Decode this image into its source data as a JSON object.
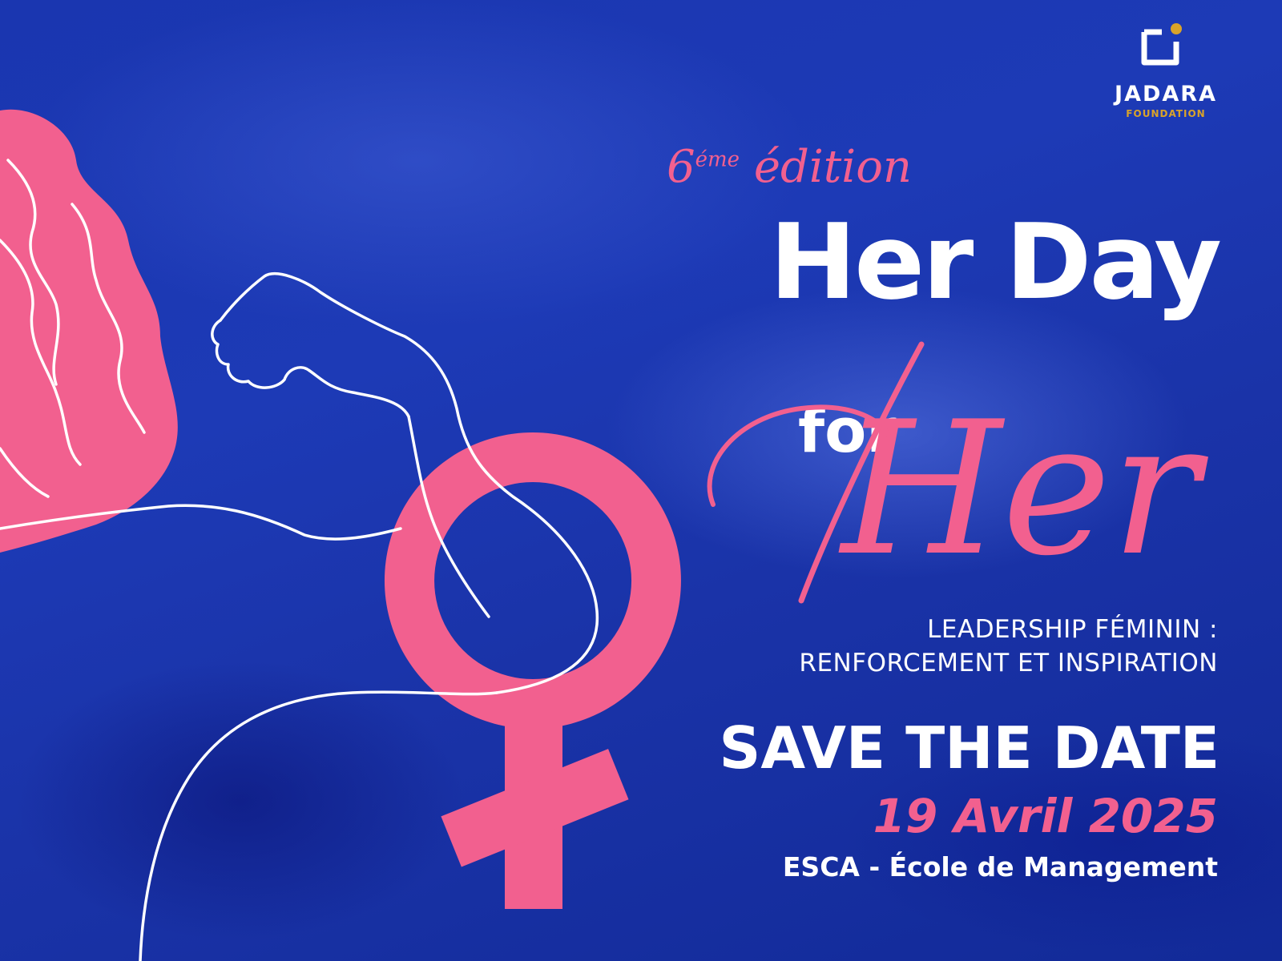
{
  "logo": {
    "name": "JADARA",
    "subtitle": "FOUNDATION",
    "accent": "#d9a32a"
  },
  "event": {
    "edition_number": "6",
    "edition_suffix": "éme",
    "edition_word": "édition",
    "title_line1": "Her Day",
    "title_for": "for",
    "title_her": "Her",
    "theme_line1": "LEADERSHIP FÉMININ :",
    "theme_line2": "RENFORCEMENT ET INSPIRATION",
    "save_the_date": "SAVE THE DATE",
    "date": "19 Avril 2025",
    "venue": "ESCA - École de Management"
  },
  "colors": {
    "background": "#1d3ab6",
    "accent_pink": "#f2608f",
    "text": "#ffffff"
  },
  "illustration": {
    "hair": "pink-hair",
    "arm": "raised-arm-outline",
    "symbol": "female-symbol"
  }
}
